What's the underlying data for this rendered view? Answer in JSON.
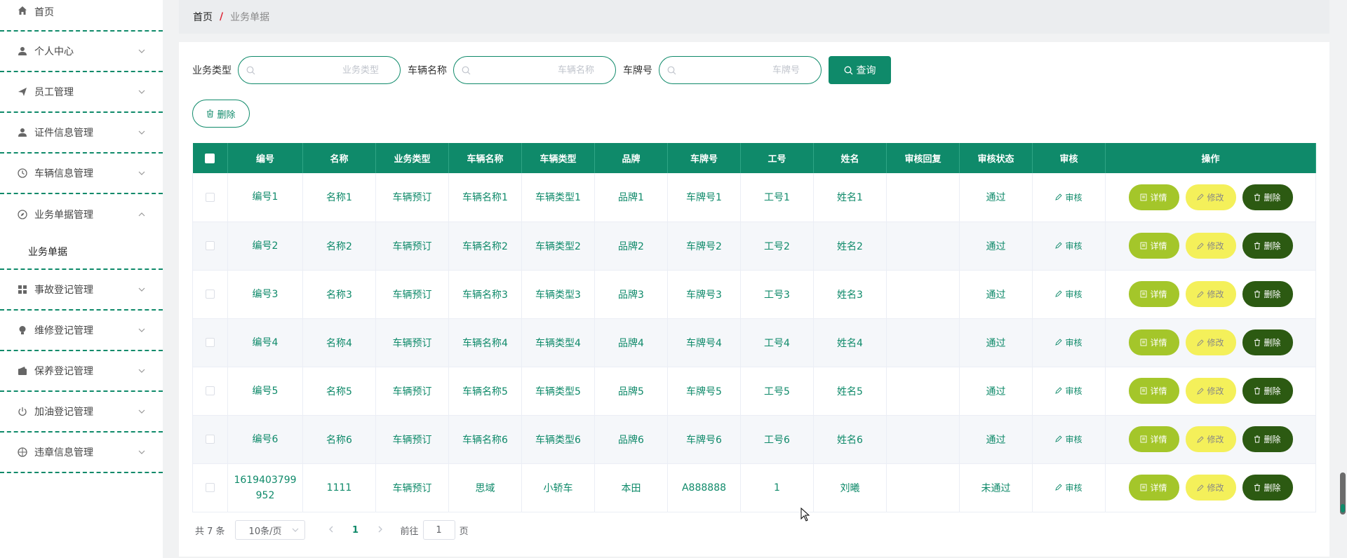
{
  "sidebar": {
    "home": "首页",
    "items": [
      {
        "label": "个人中心",
        "icon": "user-icon"
      },
      {
        "label": "员工管理",
        "icon": "send-icon"
      },
      {
        "label": "证件信息管理",
        "icon": "user-icon"
      },
      {
        "label": "车辆信息管理",
        "icon": "clock-icon"
      },
      {
        "label": "业务单据管理",
        "icon": "compass-icon",
        "open": true,
        "sub": "业务单据"
      },
      {
        "label": "事故登记管理",
        "icon": "grid-icon"
      },
      {
        "label": "维修登记管理",
        "icon": "bulb-icon"
      },
      {
        "label": "保养登记管理",
        "icon": "wallet-icon"
      },
      {
        "label": "加油登记管理",
        "icon": "power-icon"
      },
      {
        "label": "违章信息管理",
        "icon": "target-icon"
      }
    ]
  },
  "breadcrumb": {
    "home": "首页",
    "sep": "/",
    "current": "业务单据"
  },
  "search": {
    "type_label": "业务类型",
    "type_placeholder": "业务类型",
    "name_label": "车辆名称",
    "name_placeholder": "车辆名称",
    "plate_label": "车牌号",
    "plate_placeholder": "车牌号",
    "button": "查询"
  },
  "toolbar": {
    "delete": "删除"
  },
  "table": {
    "headers": [
      "编号",
      "名称",
      "业务类型",
      "车辆名称",
      "车辆类型",
      "品牌",
      "车牌号",
      "工号",
      "姓名",
      "审核回复",
      "审核状态",
      "审核",
      "操作"
    ],
    "audit_label": "审核",
    "btn_detail": "详情",
    "btn_edit": "修改",
    "btn_delete": "删除",
    "rows": [
      {
        "no": "编号1",
        "name": "名称1",
        "type": "车辆预订",
        "vname": "车辆名称1",
        "vtype": "车辆类型1",
        "brand": "品牌1",
        "plate": "车牌号1",
        "jobno": "工号1",
        "person": "姓名1",
        "reply": "",
        "status": "通过"
      },
      {
        "no": "编号2",
        "name": "名称2",
        "type": "车辆预订",
        "vname": "车辆名称2",
        "vtype": "车辆类型2",
        "brand": "品牌2",
        "plate": "车牌号2",
        "jobno": "工号2",
        "person": "姓名2",
        "reply": "",
        "status": "通过"
      },
      {
        "no": "编号3",
        "name": "名称3",
        "type": "车辆预订",
        "vname": "车辆名称3",
        "vtype": "车辆类型3",
        "brand": "品牌3",
        "plate": "车牌号3",
        "jobno": "工号3",
        "person": "姓名3",
        "reply": "",
        "status": "通过"
      },
      {
        "no": "编号4",
        "name": "名称4",
        "type": "车辆预订",
        "vname": "车辆名称4",
        "vtype": "车辆类型4",
        "brand": "品牌4",
        "plate": "车牌号4",
        "jobno": "工号4",
        "person": "姓名4",
        "reply": "",
        "status": "通过"
      },
      {
        "no": "编号5",
        "name": "名称5",
        "type": "车辆预订",
        "vname": "车辆名称5",
        "vtype": "车辆类型5",
        "brand": "品牌5",
        "plate": "车牌号5",
        "jobno": "工号5",
        "person": "姓名5",
        "reply": "",
        "status": "通过"
      },
      {
        "no": "编号6",
        "name": "名称6",
        "type": "车辆预订",
        "vname": "车辆名称6",
        "vtype": "车辆类型6",
        "brand": "品牌6",
        "plate": "车牌号6",
        "jobno": "工号6",
        "person": "姓名6",
        "reply": "",
        "status": "通过"
      },
      {
        "no": "1619403799952",
        "name": "1111",
        "type": "车辆预订",
        "vname": "思域",
        "vtype": "小轿车",
        "brand": "本田",
        "plate": "A888888",
        "jobno": "1",
        "person": "刘曦",
        "reply": "",
        "status": "未通过"
      }
    ]
  },
  "pager": {
    "total": "共 7 条",
    "page_size": "10条/页",
    "current": "1",
    "goto_prefix": "前往",
    "goto_value": "1",
    "goto_suffix": "页"
  },
  "colors": {
    "primary": "#0f8a6a",
    "detail": "#a4c62a",
    "edit": "#f4f05a",
    "delete": "#2c5a12"
  }
}
